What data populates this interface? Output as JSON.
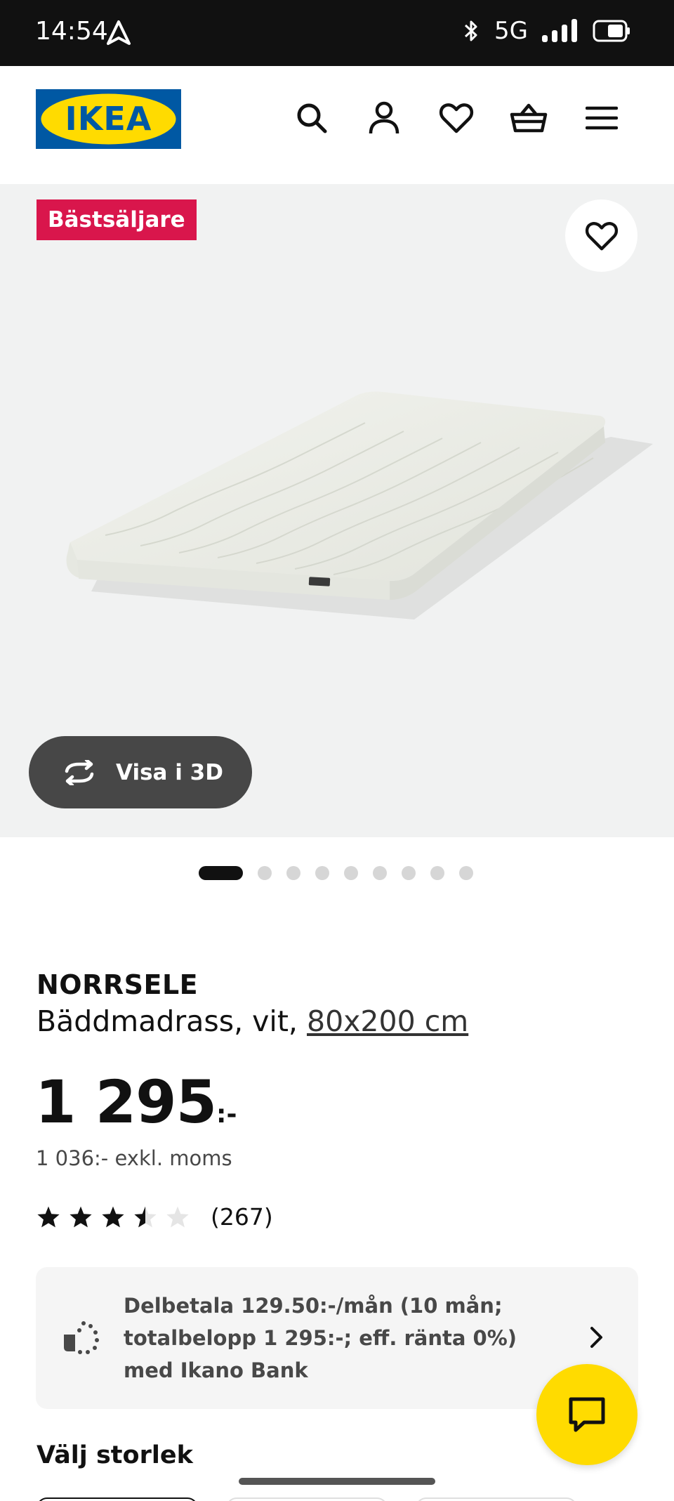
{
  "status_bar": {
    "time": "14:54",
    "network": "5G",
    "icons": [
      "navigation-arrow-icon",
      "bluetooth-icon",
      "signal-icon",
      "battery-icon"
    ]
  },
  "header": {
    "logo_text": "IKEA",
    "icons": [
      "search-icon",
      "account-icon",
      "heart-icon",
      "basket-icon",
      "menu-icon"
    ],
    "brand_colors": {
      "logo_blue": "#0058a3",
      "logo_yellow": "#ffdb00"
    }
  },
  "gallery": {
    "badge": "Bästsäljare",
    "badge_color": "#d9164c",
    "view_3d_label": "Visa i 3D",
    "image_count": 9,
    "active_image_index": 0
  },
  "product": {
    "name": "NORRSELE",
    "description": "Bäddmadrass, vit,",
    "size_link": "80x200 cm",
    "price_main": "1 295",
    "price_suffix": ":-",
    "price_ex_vat": "1 036:- exkl. moms",
    "rating": {
      "value": 3.5,
      "max": 5,
      "count_label": "(267)"
    }
  },
  "finance": {
    "text": "Delbetala 129.50:-/mån (10 mån; totalbelopp 1 295:-; eff. ränta 0%) med Ikano Bank",
    "icon": "payment-icon"
  },
  "size_section": {
    "heading": "Välj storlek"
  },
  "chat": {
    "icon": "chat-icon",
    "color": "#ffdb00"
  }
}
